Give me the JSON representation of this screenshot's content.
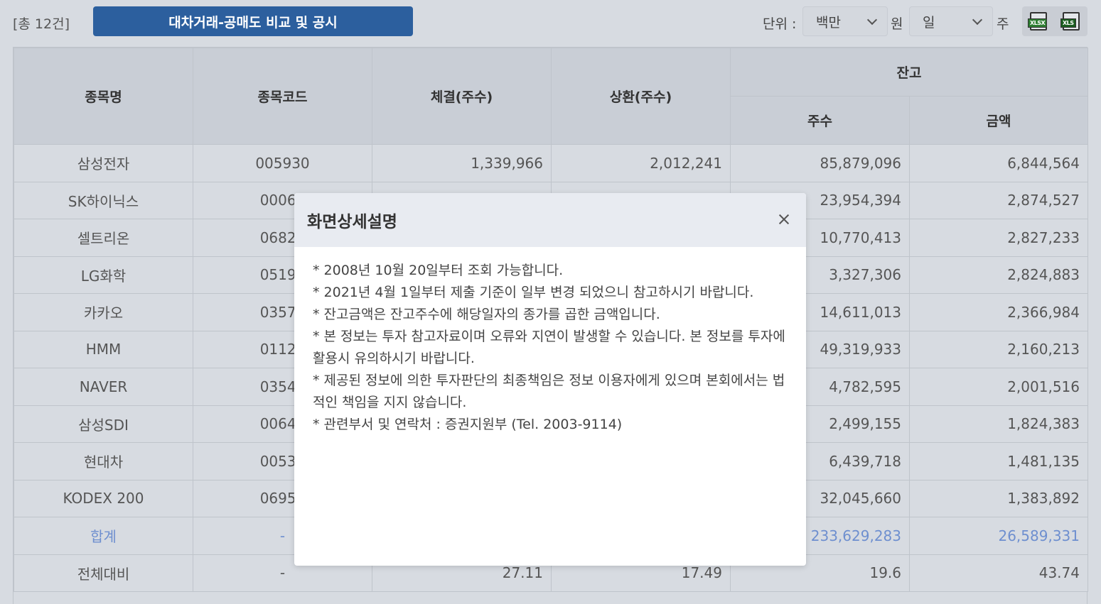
{
  "toolbar": {
    "count": "[총 12건]",
    "title_button": "대차거래-공매도 비교 및 공시",
    "unit_label": "단위 :",
    "unit_currency_value": "백만",
    "unit_currency_suffix": "원",
    "unit_share_value": "일",
    "unit_share_suffix": "주",
    "xlsx_label": "XLSX",
    "xls_label": "XLS"
  },
  "table": {
    "headers": {
      "name": "종목명",
      "code": "종목코드",
      "executed": "체결(주수)",
      "repaid": "상환(주수)",
      "balance": "잔고",
      "balance_shares": "주수",
      "balance_amount": "금액"
    },
    "rows": [
      {
        "name": "삼성전자",
        "code": "005930",
        "executed": "1,339,966",
        "repaid": "2,012,241",
        "shares": "85,879,096",
        "amount": "6,844,564"
      },
      {
        "name": "SK하이닉스",
        "code": "00066",
        "executed": "",
        "repaid": "",
        "shares": "23,954,394",
        "amount": "2,874,527"
      },
      {
        "name": "셀트리온",
        "code": "06827",
        "executed": "",
        "repaid": "",
        "shares": "10,770,413",
        "amount": "2,827,233"
      },
      {
        "name": "LG화학",
        "code": "05191",
        "executed": "",
        "repaid": "",
        "shares": "3,327,306",
        "amount": "2,824,883"
      },
      {
        "name": "카카오",
        "code": "03572",
        "executed": "",
        "repaid": "",
        "shares": "14,611,013",
        "amount": "2,366,984"
      },
      {
        "name": "HMM",
        "code": "01120",
        "executed": "",
        "repaid": "",
        "shares": "49,319,933",
        "amount": "2,160,213"
      },
      {
        "name": "NAVER",
        "code": "03542",
        "executed": "",
        "repaid": "",
        "shares": "4,782,595",
        "amount": "2,001,516"
      },
      {
        "name": "삼성SDI",
        "code": "00640",
        "executed": "",
        "repaid": "",
        "shares": "2,499,155",
        "amount": "1,824,383"
      },
      {
        "name": "현대차",
        "code": "00538",
        "executed": "",
        "repaid": "",
        "shares": "6,439,718",
        "amount": "1,481,135"
      },
      {
        "name": "KODEX 200",
        "code": "06950",
        "executed": "",
        "repaid": "",
        "shares": "32,045,660",
        "amount": "1,383,892"
      }
    ],
    "total": {
      "name": "합계",
      "code": "-",
      "executed": "",
      "repaid": "",
      "shares": "233,629,283",
      "amount": "26,589,331"
    },
    "ratio": {
      "name": "전체대비",
      "code": "-",
      "executed": "27.11",
      "repaid": "17.49",
      "shares": "19.6",
      "amount": "43.74"
    }
  },
  "modal": {
    "title": "화면상세설명",
    "lines": [
      "* 2008년 10월 20일부터 조회 가능합니다.",
      "* 2021년 4월 1일부터 제출 기준이 일부 변경 되었으니 참고하시기 바랍니다.",
      "* 잔고금액은 잔고주수에 해당일자의 종가를 곱한 금액입니다.",
      "* 본 정보는 투자 참고자료이며 오류와 지연이 발생할 수 있습니다. 본 정보를 투자에 활용시 유의하시기 바랍니다.",
      "* 제공된 정보에 의한 투자판단의 최종책임은 정보 이용자에게 있으며 본회에서는 법적인 책임을 지지 않습니다.",
      "* 관련부서 및 연락처 : 증권지원부 (Tel. 2003-9114)"
    ]
  }
}
